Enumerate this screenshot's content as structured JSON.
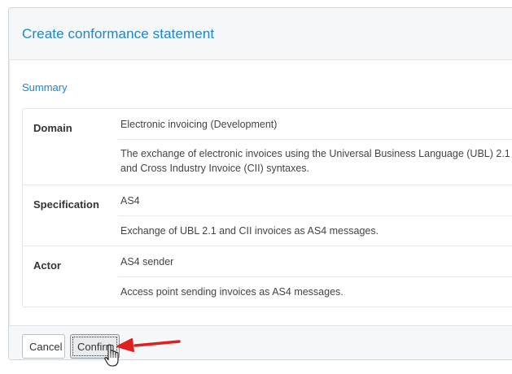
{
  "dialog": {
    "title": "Create conformance statement"
  },
  "summary": {
    "heading": "Summary",
    "rows": [
      {
        "label": "Domain",
        "values": [
          "Electronic invoicing (Development)",
          "The exchange of electronic invoices using the Universal Business Language (UBL) 2.1 and Cross Industry Invoice (CII) syntaxes."
        ]
      },
      {
        "label": "Specification",
        "values": [
          "AS4",
          "Exchange of UBL 2.1 and CII invoices as AS4 messages."
        ]
      },
      {
        "label": "Actor",
        "values": [
          "AS4 sender",
          "Access point sending invoices as AS4 messages."
        ]
      }
    ]
  },
  "footer": {
    "cancel_label": "Cancel",
    "confirm_label": "Confirm"
  },
  "colors": {
    "accent": "#1f86c9",
    "annotation_arrow": "#e02020"
  },
  "icons": {
    "annotation": "red-arrow-icon",
    "pointer": "hand-cursor-icon"
  }
}
